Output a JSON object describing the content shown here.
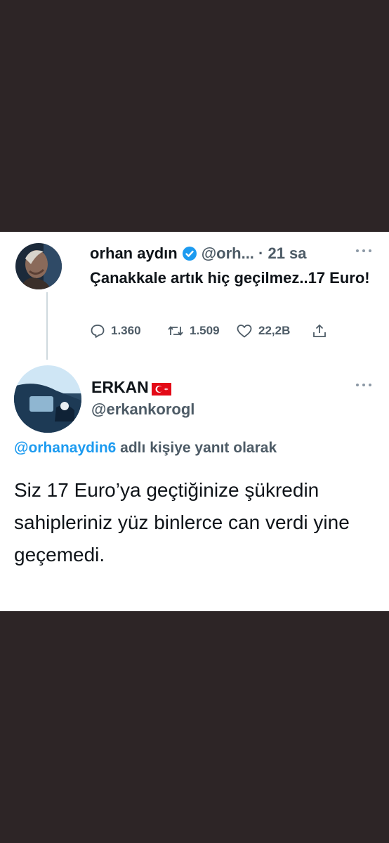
{
  "tweet1": {
    "name": "orhan aydın",
    "handle": "@orh... · 21 sa",
    "text": "Çanakkale artık hiç geçilmez..17 Euro!",
    "stats": {
      "replies": "1.360",
      "retweets": "1.509",
      "likes": "22,2B"
    }
  },
  "tweet2": {
    "name": "ERKAN",
    "handle": "@erkankorogl",
    "reply_mention": "@orhanaydin6",
    "reply_suffix": " adlı kişiye yanıt olarak",
    "text": "Siz 17 Euro’ya geçtiğinize şükredin sahipleriniz yüz binlerce can verdi yine geçemedi."
  },
  "icons": [
    "verified-badge-icon",
    "more-options-icon",
    "reply-icon",
    "retweet-icon",
    "like-icon",
    "share-icon",
    "turkey-flag-icon"
  ],
  "colors": {
    "background": "#2d2526",
    "card": "#ffffff",
    "text": "#0f1419",
    "secondary": "#4d5b66",
    "link": "#1d9bf0",
    "verified": "#1d9bf0",
    "flag": "#e30a17"
  }
}
